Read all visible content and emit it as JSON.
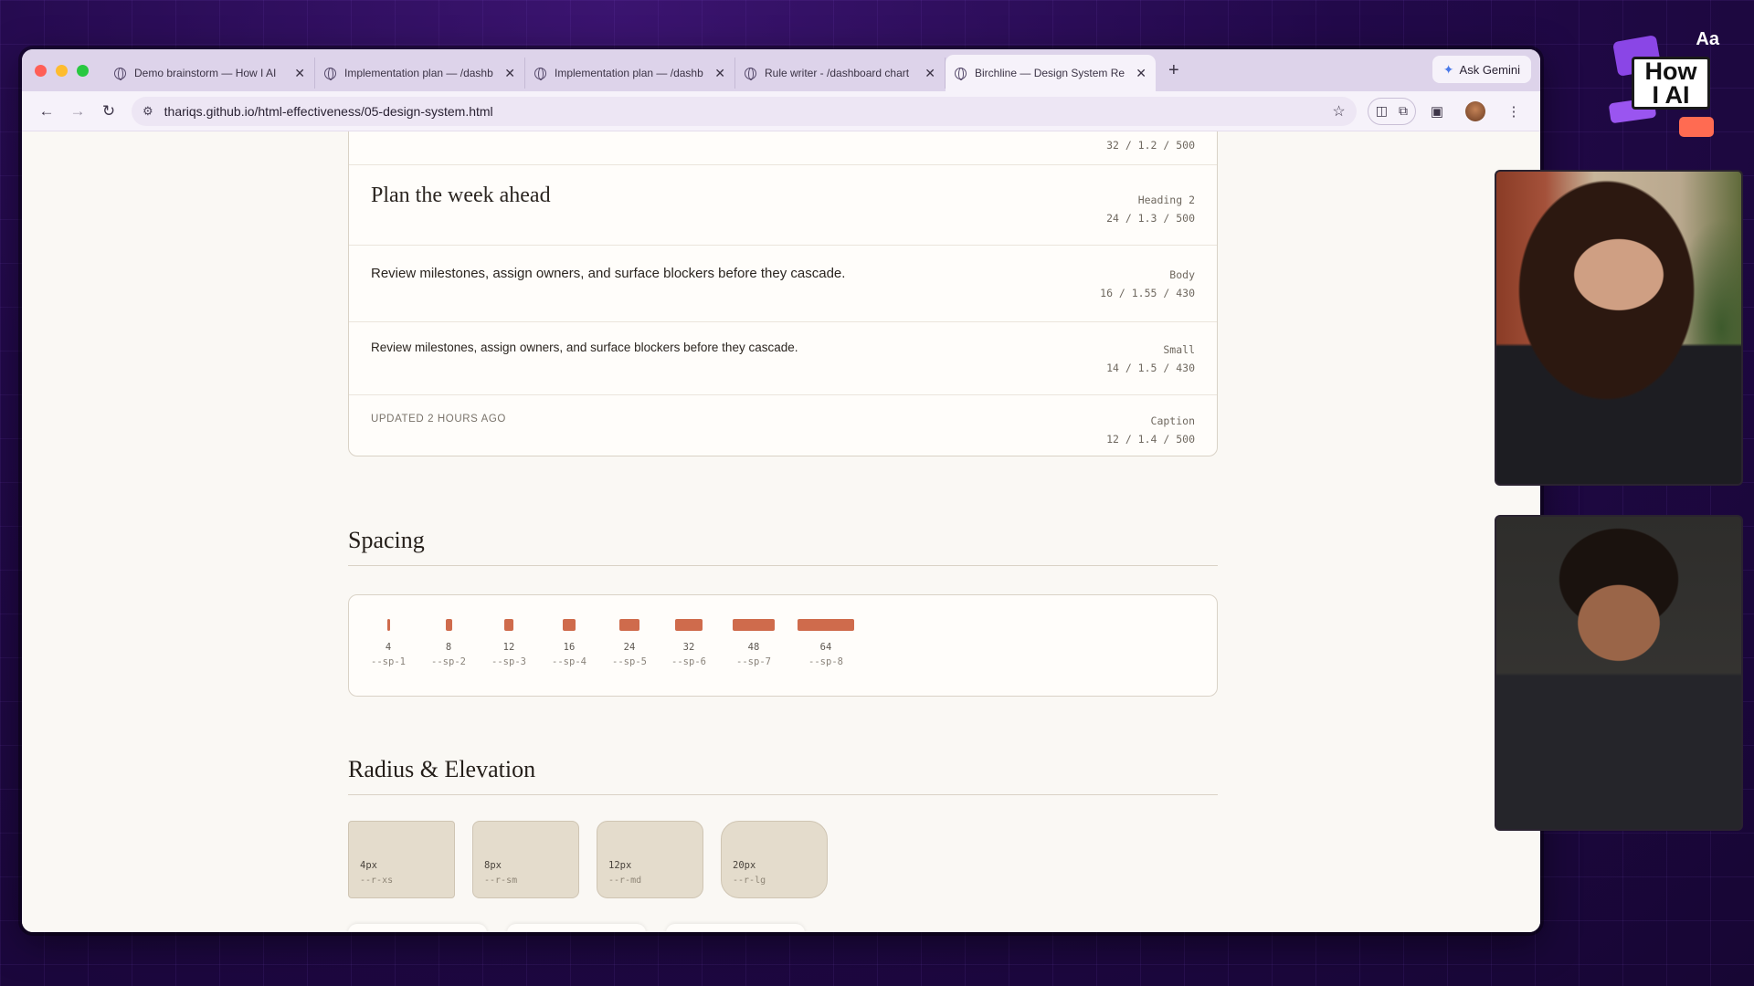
{
  "browser": {
    "tabs": [
      {
        "title": "Demo brainstorm — How I AI",
        "active": false
      },
      {
        "title": "Implementation plan — /dashb",
        "active": false
      },
      {
        "title": "Implementation plan — /dashb",
        "active": false
      },
      {
        "title": "Rule writer - /dashboard chart",
        "active": false
      },
      {
        "title": "Birchline — Design System Re",
        "active": true
      }
    ],
    "new_tab": "+",
    "ask_gemini": "Ask Gemini",
    "url": "thariqs.github.io/html-effectiveness/05-design-system.html"
  },
  "typography": {
    "rows": [
      {
        "sample": "",
        "role": "",
        "spec": "32 / 1.2 / 500"
      },
      {
        "sample": "Plan the week ahead",
        "role": "Heading 2",
        "spec": "24 / 1.3 / 500"
      },
      {
        "sample": "Review milestones, assign owners, and surface blockers before they cascade.",
        "role": "Body",
        "spec": "16 / 1.55 / 430"
      },
      {
        "sample": "Review milestones, assign owners, and surface blockers before they cascade.",
        "role": "Small",
        "spec": "14 / 1.5 / 430"
      },
      {
        "sample": "UPDATED 2 HOURS AGO",
        "role": "Caption",
        "spec": "12 / 1.4 / 500"
      }
    ]
  },
  "spacing": {
    "title": "Spacing",
    "tokens": [
      {
        "value": "4",
        "token": "--sp-1"
      },
      {
        "value": "8",
        "token": "--sp-2"
      },
      {
        "value": "12",
        "token": "--sp-3"
      },
      {
        "value": "16",
        "token": "--sp-4"
      },
      {
        "value": "24",
        "token": "--sp-5"
      },
      {
        "value": "32",
        "token": "--sp-6"
      },
      {
        "value": "48",
        "token": "--sp-7"
      },
      {
        "value": "64",
        "token": "--sp-8"
      }
    ],
    "accent_color": "#cf6b4c"
  },
  "radius": {
    "title": "Radius & Elevation",
    "tokens": [
      {
        "value": "4px",
        "token": "--r-xs"
      },
      {
        "value": "8px",
        "token": "--r-sm"
      },
      {
        "value": "12px",
        "token": "--r-md"
      },
      {
        "value": "20px",
        "token": "--r-lg"
      }
    ]
  },
  "overlay": {
    "logo_top": "Aa",
    "logo_line1": "How",
    "logo_line2": "I AI"
  }
}
